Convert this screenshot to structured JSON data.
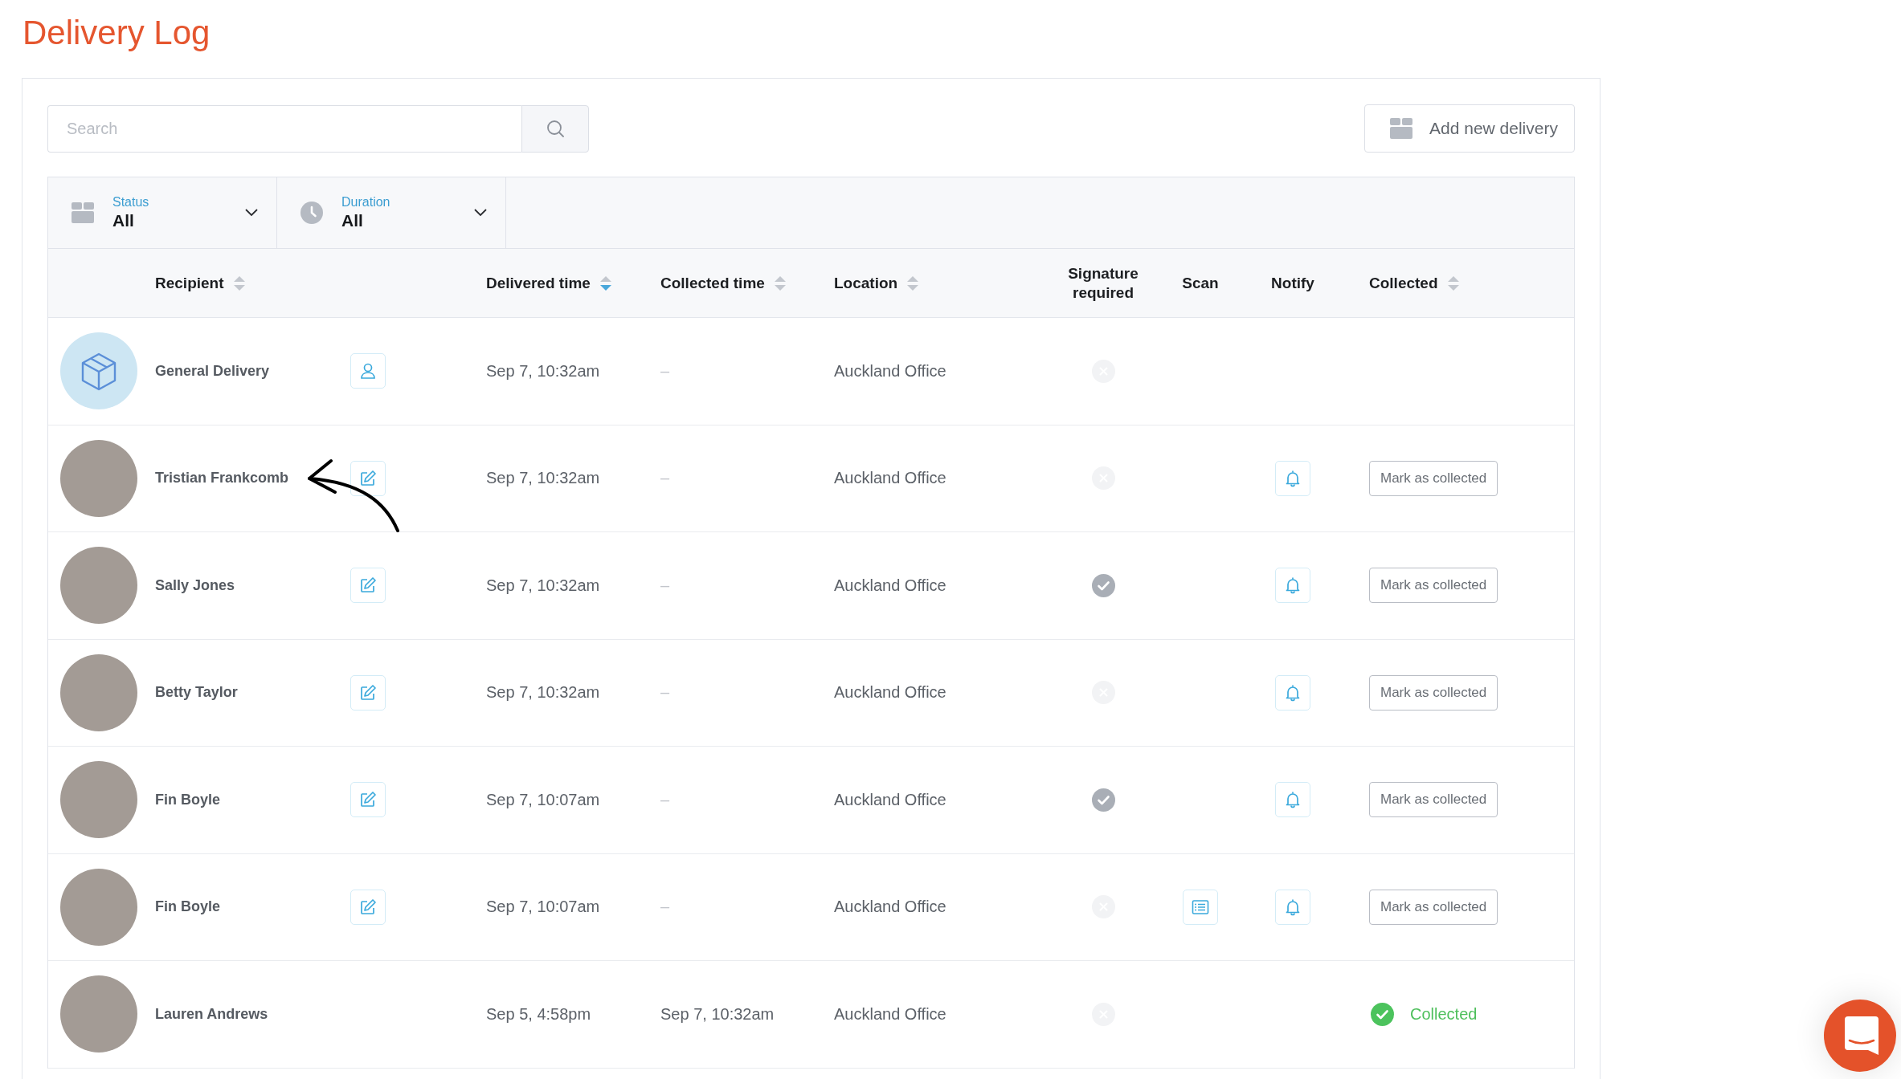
{
  "page_title": "Delivery Log",
  "search": {
    "placeholder": "Search"
  },
  "add_button": {
    "label": "Add new delivery"
  },
  "filters": [
    {
      "kind": "status",
      "label": "Status",
      "value": "All"
    },
    {
      "kind": "duration",
      "label": "Duration",
      "value": "All"
    }
  ],
  "table": {
    "columns": [
      {
        "label": "Recipient",
        "sortable": true,
        "sorted": false
      },
      {
        "label": "Delivered time",
        "sortable": true,
        "sorted": true
      },
      {
        "label": "Collected time",
        "sortable": true,
        "sorted": false
      },
      {
        "label": "Location",
        "sortable": true,
        "sorted": false
      },
      {
        "label": "Signature required",
        "sortable": false
      },
      {
        "label": "Scan",
        "sortable": false
      },
      {
        "label": "Notify",
        "sortable": false
      },
      {
        "label": "Collected",
        "sortable": true,
        "sorted": false
      }
    ],
    "rows": [
      {
        "name": "General Delivery",
        "avatar": {
          "kind": "package"
        },
        "action": {
          "kind": "assign"
        },
        "delivered_time": "Sep 7, 10:32am",
        "collected_time_placeholder": "–",
        "location": "Auckland Office",
        "signature_required": false,
        "scan": false,
        "notify": false,
        "arrow": false
      },
      {
        "name": "Tristian Frankcomb",
        "avatar": {
          "kind": "photo"
        },
        "action": {
          "kind": "edit"
        },
        "delivered_time": "Sep 7, 10:32am",
        "collected_time_placeholder": "–",
        "location": "Auckland Office",
        "signature_required": false,
        "scan": false,
        "notify": true,
        "collected": {
          "kind": "button",
          "label": "Mark as collected"
        },
        "arrow": true
      },
      {
        "name": "Sally Jones",
        "avatar": {
          "kind": "photo"
        },
        "action": {
          "kind": "edit"
        },
        "delivered_time": "Sep 7, 10:32am",
        "collected_time_placeholder": "–",
        "location": "Auckland Office",
        "signature_required": true,
        "scan": false,
        "notify": true,
        "collected": {
          "kind": "button",
          "label": "Mark as collected"
        },
        "arrow": false
      },
      {
        "name": "Betty Taylor",
        "avatar": {
          "kind": "photo"
        },
        "action": {
          "kind": "edit"
        },
        "delivered_time": "Sep 7, 10:32am",
        "collected_time_placeholder": "–",
        "location": "Auckland Office",
        "signature_required": false,
        "scan": false,
        "notify": true,
        "collected": {
          "kind": "button",
          "label": "Mark as collected"
        },
        "arrow": false
      },
      {
        "name": "Fin Boyle",
        "avatar": {
          "kind": "photo"
        },
        "action": {
          "kind": "edit"
        },
        "delivered_time": "Sep 7, 10:07am",
        "collected_time_placeholder": "–",
        "location": "Auckland Office",
        "signature_required": true,
        "scan": false,
        "notify": true,
        "collected": {
          "kind": "button",
          "label": "Mark as collected"
        },
        "arrow": false
      },
      {
        "name": "Fin Boyle",
        "avatar": {
          "kind": "photo"
        },
        "action": {
          "kind": "edit"
        },
        "delivered_time": "Sep 7, 10:07am",
        "collected_time_placeholder": "–",
        "location": "Auckland Office",
        "signature_required": false,
        "scan": true,
        "notify": true,
        "collected": {
          "kind": "button",
          "label": "Mark as collected"
        },
        "arrow": false
      },
      {
        "name": "Lauren Andrews",
        "avatar": {
          "kind": "photo"
        },
        "delivered_time": "Sep 5, 4:58pm",
        "collected_time": "Sep 7, 10:32am",
        "location": "Auckland Office",
        "signature_required": false,
        "scan": false,
        "notify": false,
        "collected": {
          "kind": "status",
          "label": "Collected"
        },
        "arrow": false
      }
    ]
  }
}
